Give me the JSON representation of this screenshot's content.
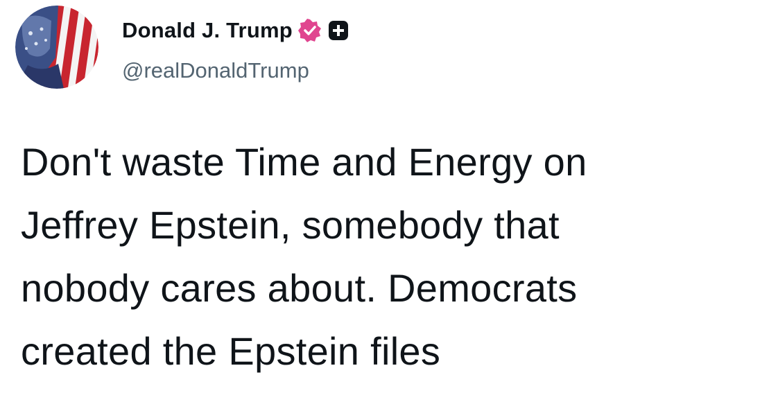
{
  "post": {
    "author": {
      "display_name": "Donald J. Trump",
      "handle": "@realDonaldTrump",
      "avatar_icon": "flag-portrait-avatar",
      "verified_icon": "verified-badge-icon",
      "affiliate_icon": "affiliate-badge-icon"
    },
    "text": "Don't waste Time and Energy on\nJeffrey Epstein, somebody that\nnobody cares about. Democrats\ncreated the Epstein files"
  },
  "colors": {
    "text_primary": "#0f1419",
    "text_secondary": "#536471",
    "verified_badge": "#e0458f",
    "background": "#ffffff"
  }
}
